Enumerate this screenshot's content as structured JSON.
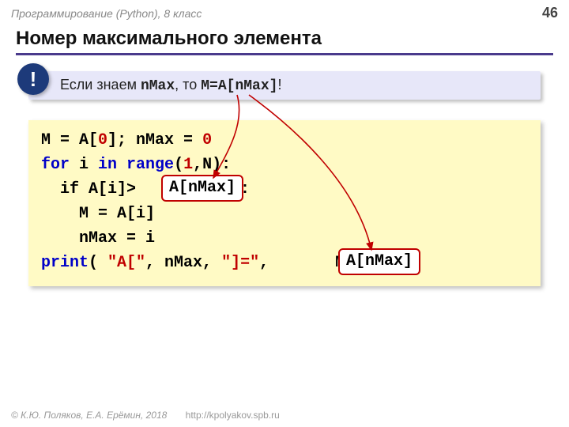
{
  "header": {
    "course": "Программирование (Python), 8 класс",
    "page": "46"
  },
  "title": "Номер максимального элемента",
  "tip": {
    "bang": "!",
    "pre": "Если знаем ",
    "mono1": "nMax",
    "mid": ", то ",
    "mono2": "M=A[nMax]",
    "post": "!"
  },
  "code": {
    "l1a": "M = A[",
    "l1zero": "0",
    "l1b": "]; nMax = ",
    "l1zero2": "0",
    "l2a": "for",
    "l2b": " i ",
    "l2c": "in",
    "l2d": " range",
    "l2e": "(",
    "l2one": "1",
    "l2f": ",N):",
    "l3a": "  if A[i]>     M     :",
    "l4a": "    M = A[i]",
    "l5a": "    nMax = i",
    "l6a": "print",
    "l6b": "( ",
    "l6s1": "\"A[\"",
    "l6c": ", nMax, ",
    "l6s2": "\"]=\"",
    "l6d": ", ",
    "l6m": "      M",
    "l6e": " )"
  },
  "overlay": {
    "o1": "A[nMax]",
    "o2": "A[nMax]"
  },
  "footer": {
    "copy": "© К.Ю. Поляков, Е.А. Ерёмин, 2018",
    "url": "http://kpolyakov.spb.ru"
  }
}
